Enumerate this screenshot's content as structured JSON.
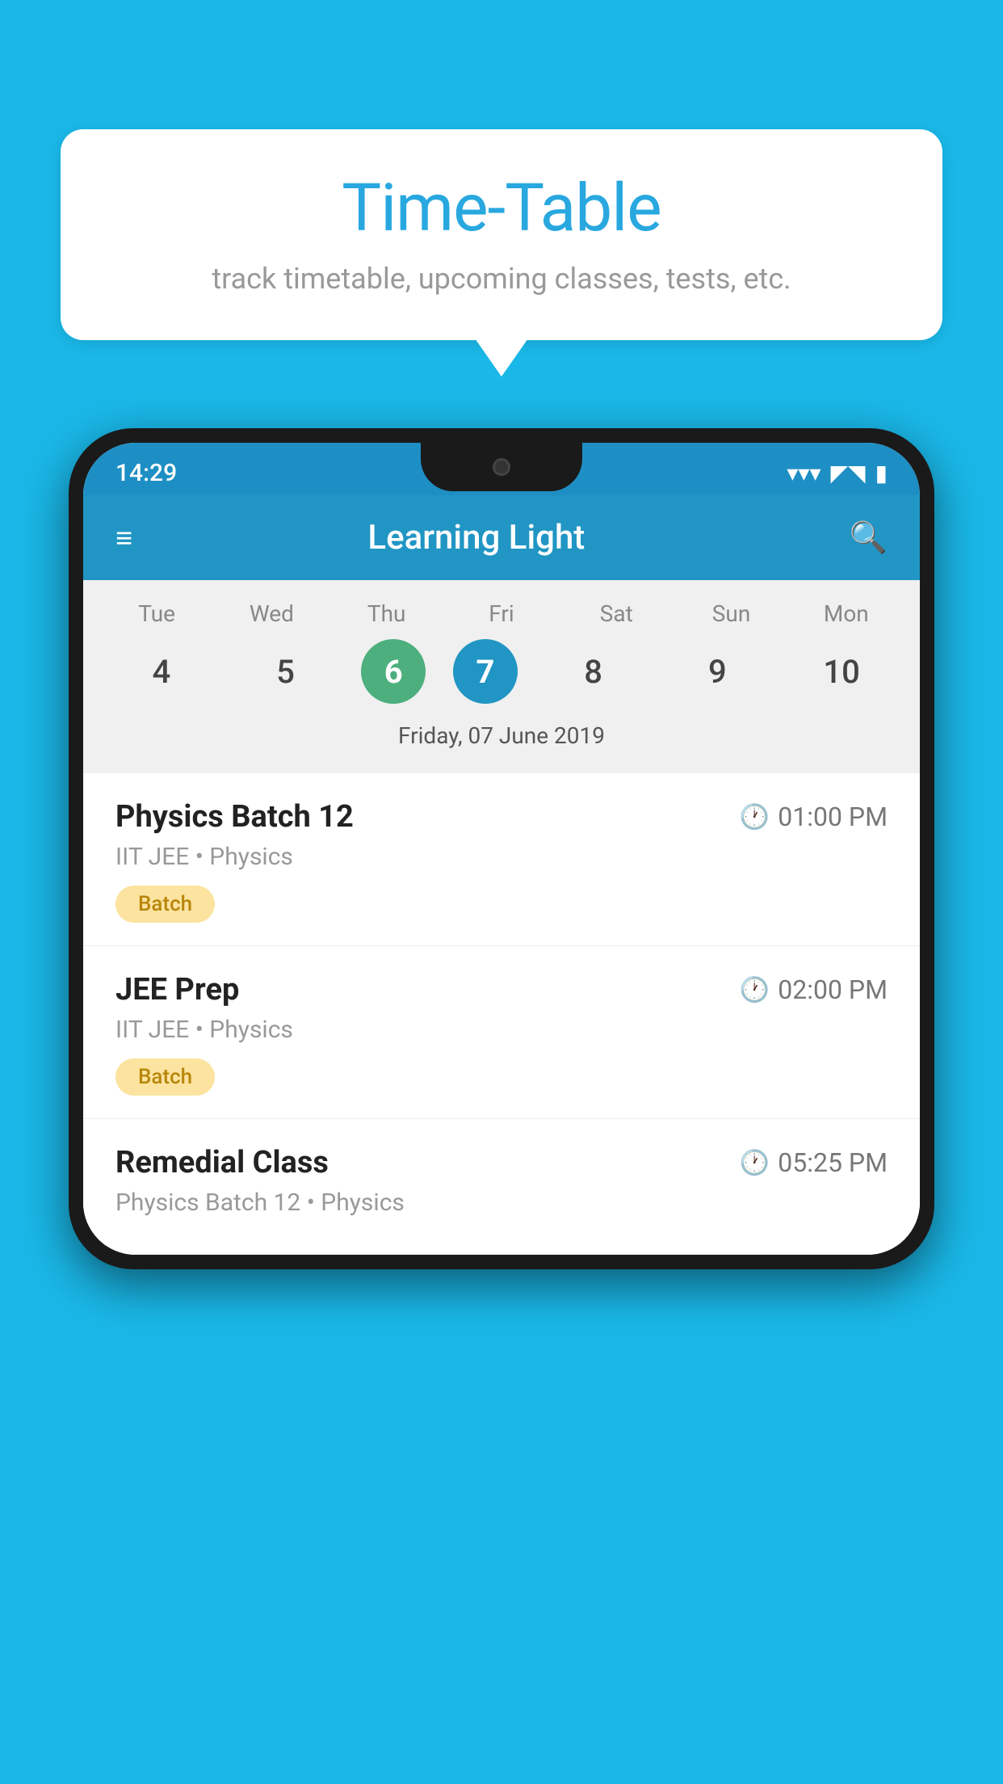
{
  "background_color": "#1ab8e8",
  "speech_bubble": {
    "title": "Time-Table",
    "subtitle": "track timetable, upcoming classes, tests, etc."
  },
  "phone": {
    "status_bar": {
      "time": "14:29",
      "wifi": "▾",
      "signal": "▲",
      "battery": "▮"
    },
    "app_header": {
      "title": "Learning Light",
      "hamburger": "≡",
      "search": "🔍"
    },
    "calendar": {
      "days": [
        "Tue",
        "Wed",
        "Thu",
        "Fri",
        "Sat",
        "Sun",
        "Mon"
      ],
      "dates": [
        "4",
        "5",
        "6",
        "7",
        "8",
        "9",
        "10"
      ],
      "today_index": 2,
      "selected_index": 3,
      "selected_label": "Friday, 07 June 2019"
    },
    "classes": [
      {
        "name": "Physics Batch 12",
        "time": "01:00 PM",
        "course": "IIT JEE • Physics",
        "tag": "Batch"
      },
      {
        "name": "JEE Prep",
        "time": "02:00 PM",
        "course": "IIT JEE • Physics",
        "tag": "Batch"
      },
      {
        "name": "Remedial Class",
        "time": "05:25 PM",
        "course": "Physics Batch 12 • Physics",
        "tag": ""
      }
    ]
  }
}
